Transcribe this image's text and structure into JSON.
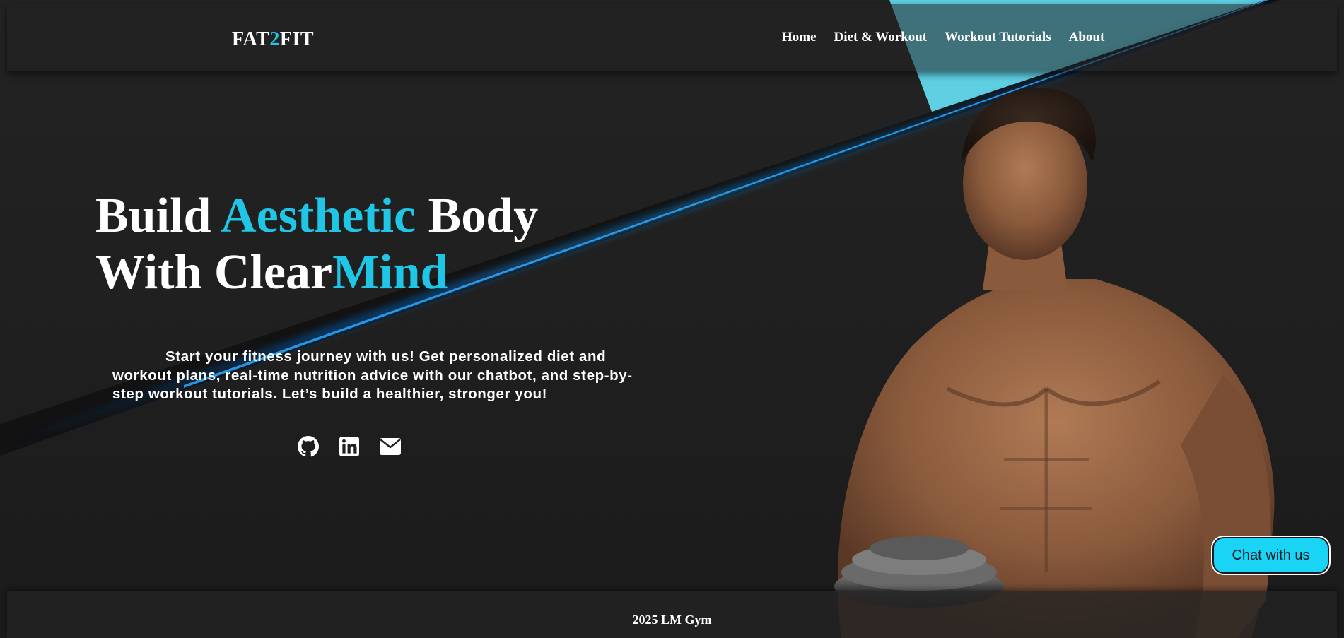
{
  "header": {
    "logo": {
      "part1": "FAT",
      "part2": "2",
      "part3": "FIT"
    },
    "nav": [
      {
        "label": "Home"
      },
      {
        "label": "Diet & Workout"
      },
      {
        "label": "Workout Tutorials"
      },
      {
        "label": "About"
      }
    ]
  },
  "hero": {
    "headline": {
      "line1_a": "Build ",
      "line1_accent": "Aesthetic",
      "line1_b": " Body",
      "line2_a": "With Clear",
      "line2_accent": "Mind"
    },
    "intro": "Start your fitness journey with us! Get personalized diet and workout plans, real-time nutrition advice with our chatbot, and step-by-step workout tutorials. Let’s build a healthier, stronger you!",
    "socials": [
      {
        "icon": "github-icon"
      },
      {
        "icon": "linkedin-icon"
      },
      {
        "icon": "envelope-icon"
      }
    ]
  },
  "chat": {
    "label": "Chat with us"
  },
  "footer": {
    "text": "2025 LM Gym"
  },
  "colors": {
    "accent": "#1fc6e6",
    "triangle": "#5fd0e2",
    "chat_button": "#19d4f4",
    "background": "#1f1f1f"
  }
}
